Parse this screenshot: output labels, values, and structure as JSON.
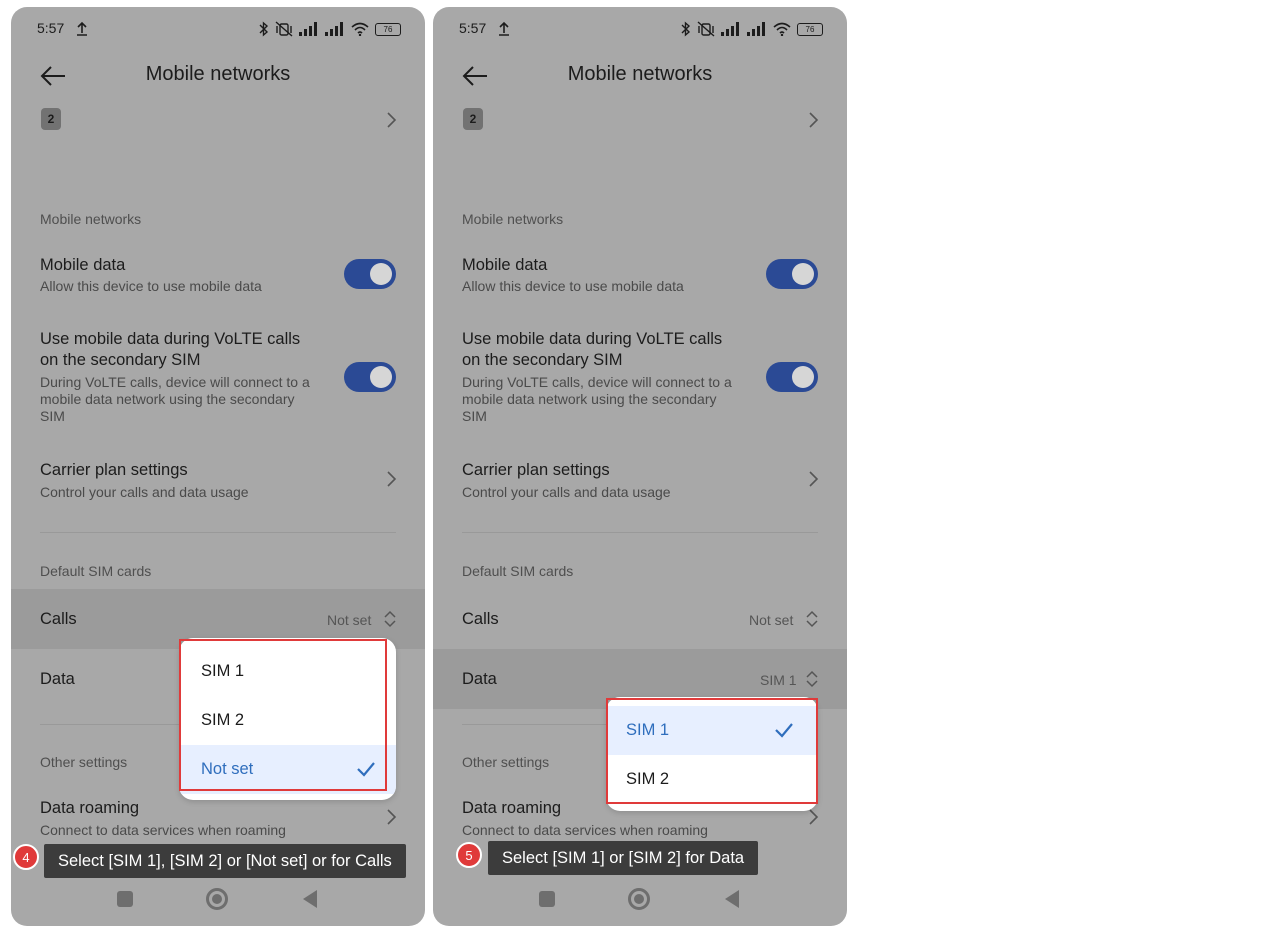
{
  "colors": {
    "overlay_bg": "#a8a8a8",
    "toggle_on": "#2b4a95",
    "selected_text": "#2f6ebd",
    "selected_bg": "#e7efff",
    "annotation_red": "#e03a3a",
    "caption_bg": "#3c3c3c"
  },
  "screens": [
    {
      "status": {
        "time": "5:57",
        "battery": "76"
      },
      "header": {
        "title": "Mobile networks"
      },
      "sim_chip": "2",
      "section_mobile": "Mobile networks",
      "mobile_data": {
        "title": "Mobile data",
        "subtitle": "Allow this device to use mobile data"
      },
      "volte": {
        "title_line1": "Use mobile data during VoLTE calls",
        "title_line2": "on the secondary SIM",
        "sub_line1": "During VoLTE calls, device will connect to a",
        "sub_line2": "mobile data network using the secondary",
        "sub_line3": "SIM"
      },
      "carrier": {
        "title": "Carrier plan settings",
        "subtitle": "Control your calls and data usage"
      },
      "section_default": "Default SIM cards",
      "calls": {
        "label": "Calls",
        "value": "Not set"
      },
      "data": {
        "label": "Data"
      },
      "section_other": "Other settings",
      "roaming": {
        "title": "Data roaming",
        "subtitle": "Connect to data services when roaming"
      },
      "dropdown": {
        "options": [
          "SIM 1",
          "SIM 2",
          "Not set"
        ],
        "selected": "Not set"
      },
      "step": {
        "number": "4",
        "caption": "Select [SIM 1], [SIM 2] or [Not set] or for Calls"
      }
    },
    {
      "status": {
        "time": "5:57",
        "battery": "76"
      },
      "header": {
        "title": "Mobile networks"
      },
      "sim_chip": "2",
      "section_mobile": "Mobile networks",
      "mobile_data": {
        "title": "Mobile data",
        "subtitle": "Allow this device to use mobile data"
      },
      "volte": {
        "title_line1": "Use mobile data during VoLTE calls",
        "title_line2": "on the secondary SIM",
        "sub_line1": "During VoLTE calls, device will connect to a",
        "sub_line2": "mobile data network using the secondary",
        "sub_line3": "SIM"
      },
      "carrier": {
        "title": "Carrier plan settings",
        "subtitle": "Control your calls and data usage"
      },
      "section_default": "Default SIM cards",
      "calls": {
        "label": "Calls",
        "value": "Not set"
      },
      "data": {
        "label": "Data",
        "value": "SIM 1"
      },
      "section_other": "Other settings",
      "roaming": {
        "title": "Data roaming",
        "subtitle": "Connect to data services when roaming"
      },
      "dropdown": {
        "options": [
          "SIM 1",
          "SIM 2"
        ],
        "selected": "SIM 1"
      },
      "step": {
        "number": "5",
        "caption": "Select [SIM 1] or [SIM 2] for Data"
      }
    }
  ]
}
